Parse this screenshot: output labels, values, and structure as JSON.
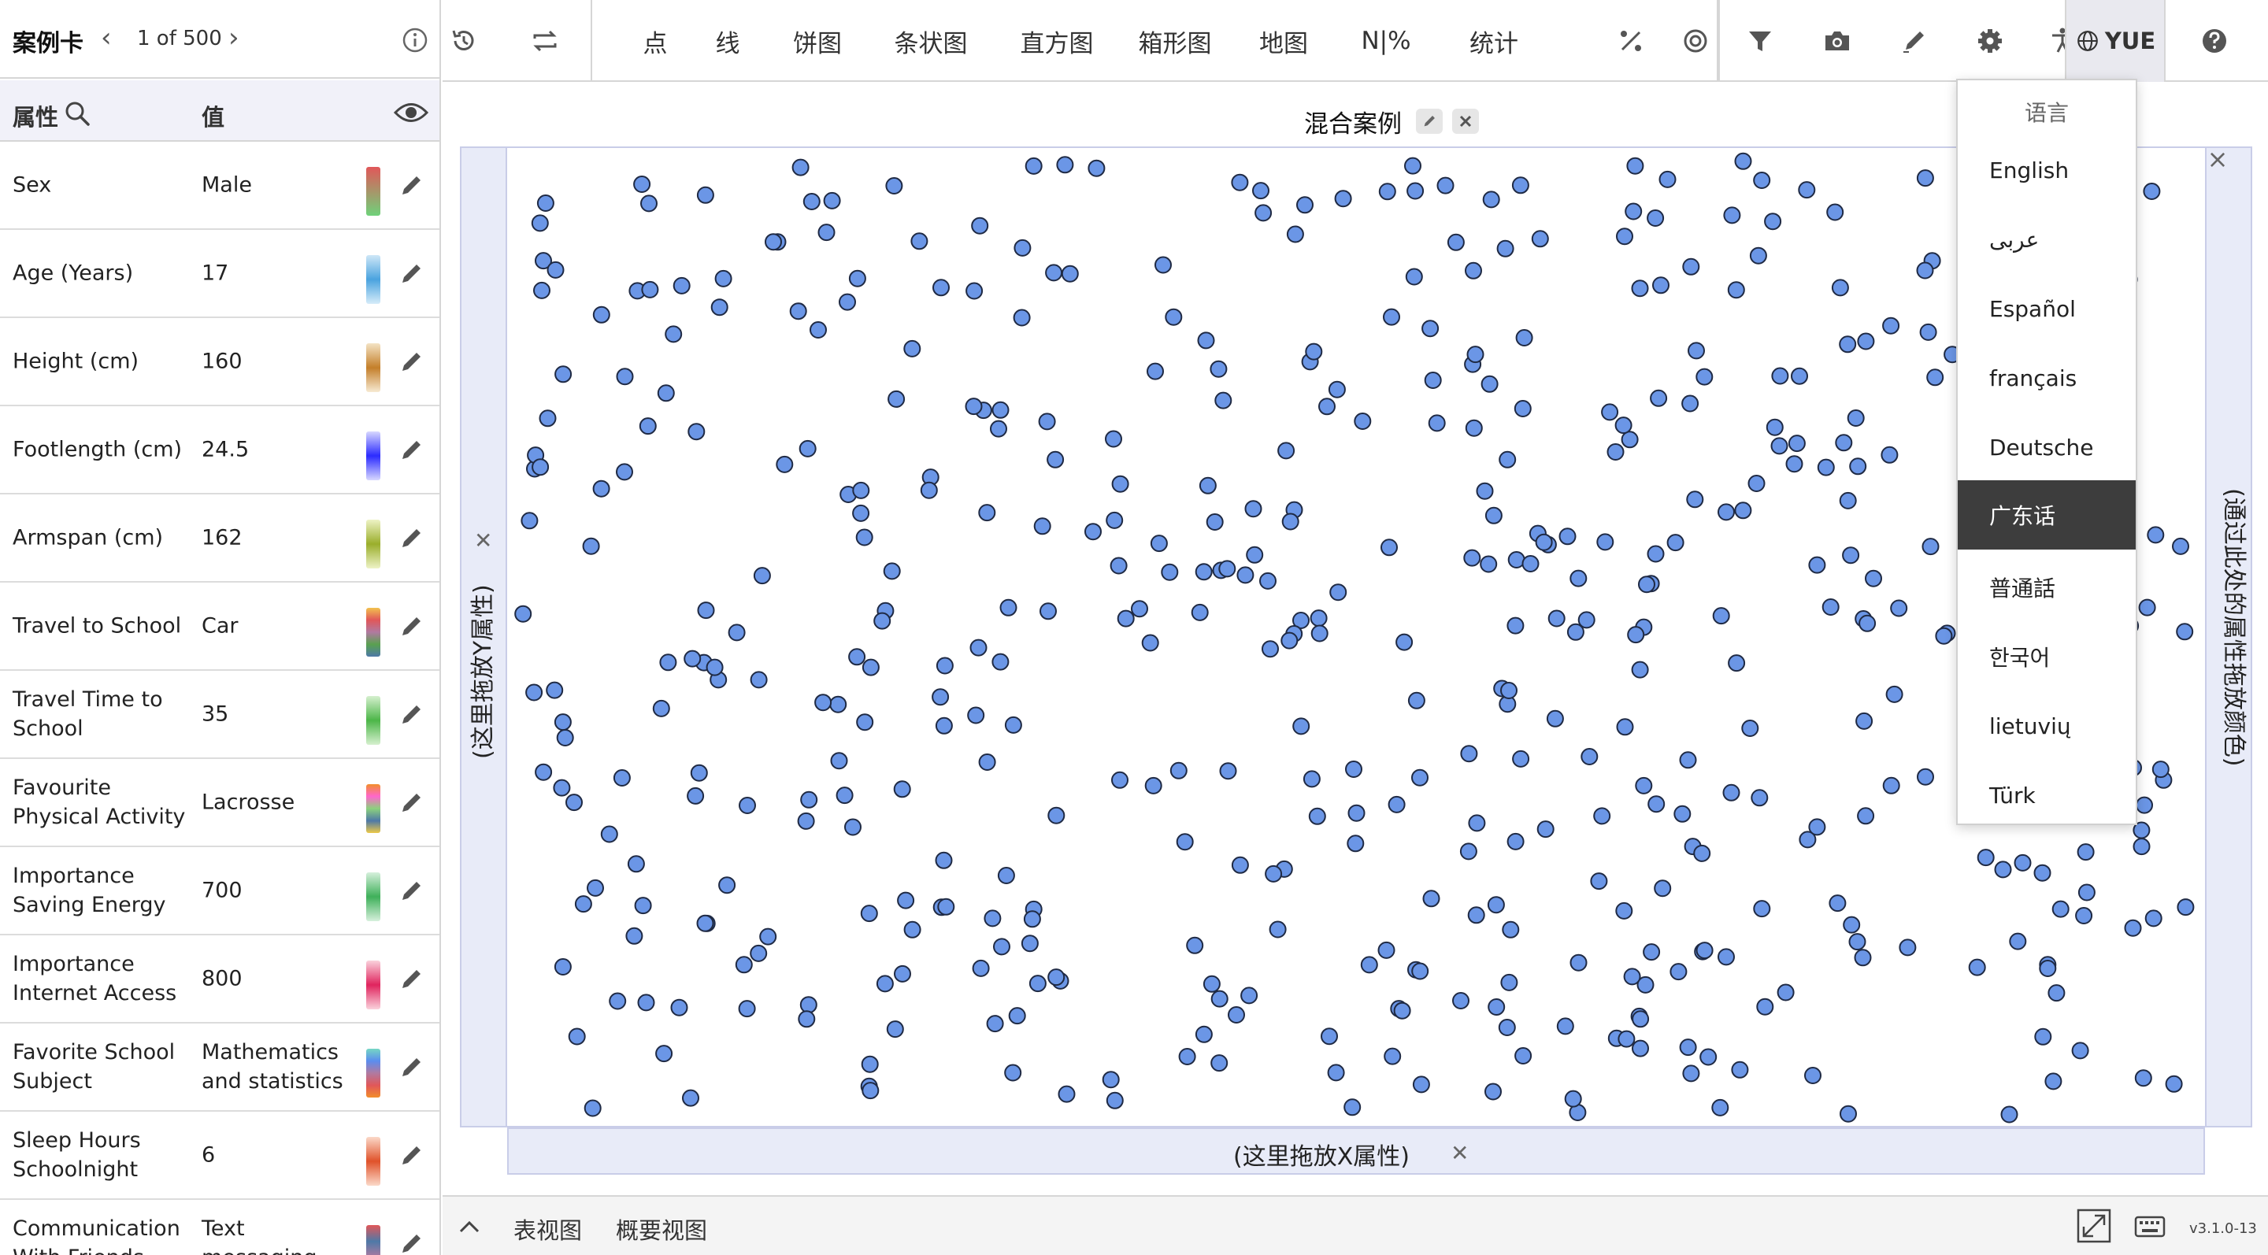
{
  "case_card": {
    "title": "案例卡",
    "counter": "1 of 500",
    "prev": "‹",
    "next": "›",
    "attribute_header": "属性",
    "value_header": "值",
    "rows": [
      {
        "attribute": "Sex",
        "value": "Male",
        "colors": [
          "#e15759",
          "#6fd27a"
        ]
      },
      {
        "attribute": "Age (Years)",
        "value": "17",
        "colors": [
          "#cfe7f7",
          "#4aa3df",
          "#d6ecf9"
        ]
      },
      {
        "attribute": "Height (cm)",
        "value": "160",
        "colors": [
          "#f4e3c5",
          "#c47f2a",
          "#f7ead2"
        ]
      },
      {
        "attribute": "Footlength (cm)",
        "value": "24.5",
        "colors": [
          "#d8d8ff",
          "#2b2bff",
          "#d8d8ff"
        ]
      },
      {
        "attribute": "Armspan (cm)",
        "value": "162",
        "colors": [
          "#eef3c6",
          "#9aae2b",
          "#eef3c6"
        ]
      },
      {
        "attribute": "Travel to School",
        "value": "Car",
        "colors": [
          "#f2c14e",
          "#e15759",
          "#b07aa1",
          "#59a14f",
          "#4e79a7"
        ]
      },
      {
        "attribute": "Travel Time to School",
        "value": "35",
        "colors": [
          "#d6f0cf",
          "#4cb648",
          "#d6f0cf"
        ]
      },
      {
        "attribute": "Favourite Physical Activity",
        "value": "Lacrosse",
        "colors": [
          "#f28e2b",
          "#ff66cc",
          "#8cd17d",
          "#4e79a7",
          "#edc948"
        ]
      },
      {
        "attribute": "Importance Saving Energy",
        "value": "700",
        "colors": [
          "#d6f0dc",
          "#3fb05a",
          "#d6f0dc"
        ]
      },
      {
        "attribute": "Importance Internet Access",
        "value": "800",
        "colors": [
          "#fad2dc",
          "#e0245e",
          "#fad2dc"
        ]
      },
      {
        "attribute": "Favorite School Subject",
        "value": "Mathematics and statistics",
        "colors": [
          "#76d7c4",
          "#5b8def",
          "#b07aa1",
          "#e15759",
          "#f28e2b"
        ]
      },
      {
        "attribute": "Sleep Hours Schoolnight",
        "value": "6",
        "colors": [
          "#fbd9c9",
          "#e0522a",
          "#fbd9c9"
        ]
      },
      {
        "attribute": "Communication With Friends",
        "value": "Text messaging",
        "colors": [
          "#e15759",
          "#4e79a7",
          "#b07aa1",
          "#59a14f"
        ]
      }
    ]
  },
  "toolbar": {
    "text_buttons": [
      {
        "name": "points",
        "label": "点"
      },
      {
        "name": "lines",
        "label": "线"
      },
      {
        "name": "pie",
        "label": "饼图"
      },
      {
        "name": "bar",
        "label": "条状图"
      },
      {
        "name": "histogram",
        "label": "直方图"
      },
      {
        "name": "boxplot",
        "label": "箱形图"
      },
      {
        "name": "map",
        "label": "地图"
      },
      {
        "name": "percent",
        "label": "N|%"
      },
      {
        "name": "stats",
        "label": "统计"
      }
    ],
    "language_label": "YUE"
  },
  "graph": {
    "title": "混合案例",
    "y_drop_label": "(这里拖放Y属性)",
    "x_drop_label": "(这里拖放X属性)",
    "legend_drop_label": "(通过此处的属性拖放颜色)",
    "point_color": "#6b96e6",
    "point_stroke": "#1f2a44"
  },
  "bottom_bar": {
    "table_view": "表视图",
    "summary_view": "概要视图",
    "version": "v3.1.0-13"
  },
  "language_menu": {
    "header": "语言",
    "items": [
      {
        "label": "English",
        "active": false
      },
      {
        "label": "عربى",
        "active": false
      },
      {
        "label": "Español",
        "active": false
      },
      {
        "label": "français",
        "active": false
      },
      {
        "label": "Deutsche",
        "active": false
      },
      {
        "label": "广东话",
        "active": true
      },
      {
        "label": "普通話",
        "active": false
      },
      {
        "label": "한국어",
        "active": false
      },
      {
        "label": "lietuvių",
        "active": false
      },
      {
        "label": "Türk",
        "active": false
      }
    ]
  },
  "chart_data": {
    "type": "scatter",
    "point_count": 500,
    "title": "混合案例",
    "xlabel": "(这里拖放X属性)",
    "ylabel": "(这里拖放Y属性)",
    "layout": "random scattered points (no X/Y attributes assigned)"
  }
}
